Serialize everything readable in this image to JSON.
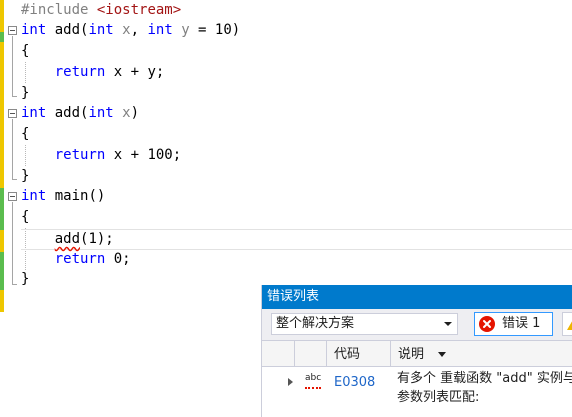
{
  "editor": {
    "line_1_directive": "#include",
    "line_1_header": "<iostream>",
    "line_2_type": "int",
    "line_2_name": " add(",
    "line_2_param_type_a": "int",
    "line_2_param_a": " x",
    "line_2_comma": ", ",
    "line_2_param_type_b": "int",
    "line_2_param_b": " y",
    "line_2_tail": " = 10)",
    "line_3": "{",
    "line_4_keyword": "return",
    "line_4_expr": " x + y;",
    "line_5": "}",
    "line_6_type": "int",
    "line_6_name": " add(",
    "line_6_param_type": "int",
    "line_6_param": " x",
    "line_6_close": ")",
    "line_7": "{",
    "line_8_keyword": "return",
    "line_8_expr": " x + 100;",
    "line_9": "}",
    "line_10_type": "int",
    "line_10_name": " main()",
    "line_11": "{",
    "line_12_call": "add",
    "line_12_rest": "(1);",
    "line_13_keyword": "return",
    "line_13_expr": " 0;",
    "line_14": "}"
  },
  "error_list": {
    "title": "错误列表",
    "scope_selected": "整个解决方案",
    "errors_button_label": "错误 1",
    "columns": {
      "code": "代码",
      "description": "说明"
    },
    "rows": [
      {
        "code": "E0308",
        "description": "有多个 重载函数 \"add\" 实例与参数列表匹配:"
      }
    ]
  },
  "colors": {
    "keyword": "#0000ff",
    "preprocessor": "#808080",
    "include_string": "#a31515",
    "panel_title_bg": "#007acc",
    "error_red": "#e51400"
  }
}
